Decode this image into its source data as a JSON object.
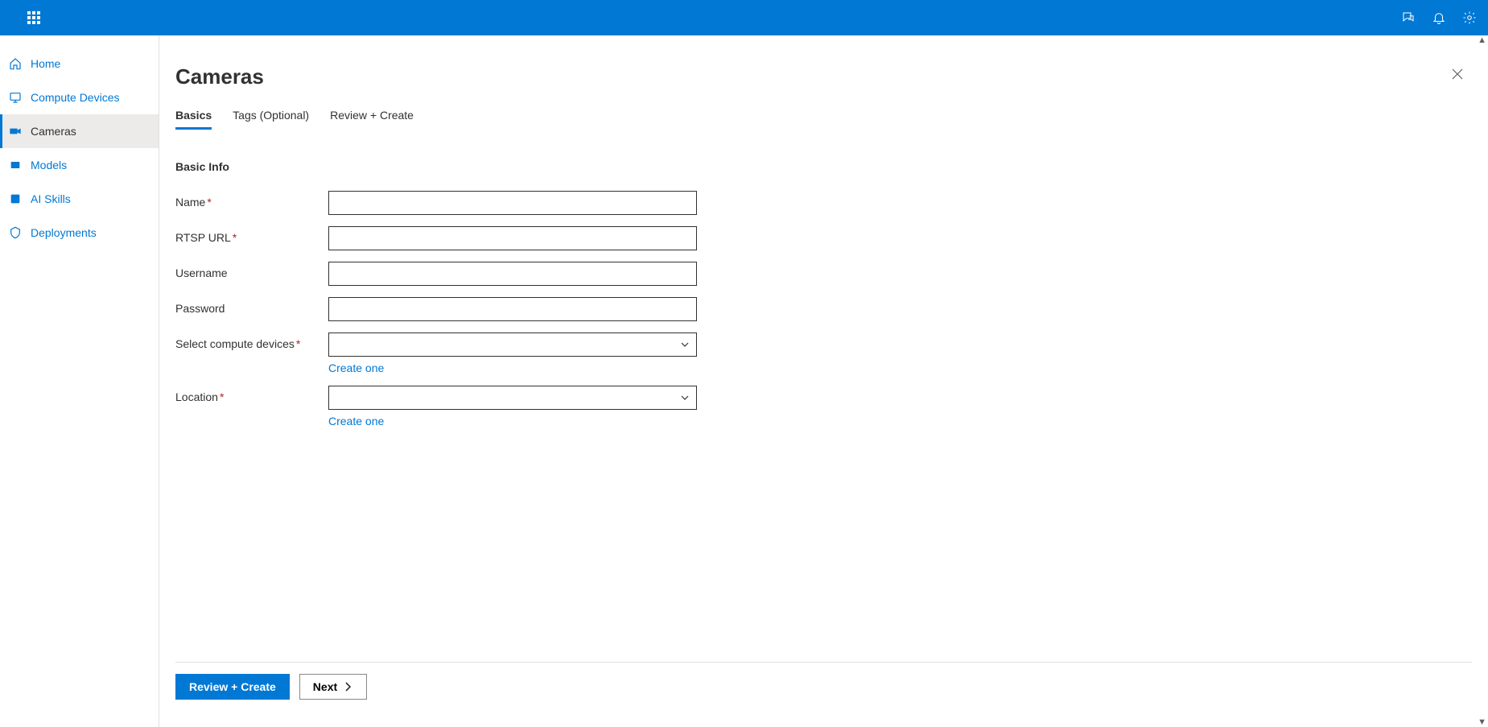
{
  "sidebar": {
    "items": [
      {
        "label": "Home",
        "icon": "home-icon",
        "active": false
      },
      {
        "label": "Compute Devices",
        "icon": "device-icon",
        "active": false
      },
      {
        "label": "Cameras",
        "icon": "camera-icon",
        "active": true
      },
      {
        "label": "Models",
        "icon": "models-icon",
        "active": false
      },
      {
        "label": "AI Skills",
        "icon": "ai-skills-icon",
        "active": false
      },
      {
        "label": "Deployments",
        "icon": "deployments-icon",
        "active": false
      }
    ]
  },
  "page": {
    "title": "Cameras"
  },
  "tabs": [
    {
      "label": "Basics",
      "active": true
    },
    {
      "label": "Tags (Optional)",
      "active": false
    },
    {
      "label": "Review + Create",
      "active": false
    }
  ],
  "form": {
    "section_heading": "Basic Info",
    "fields": {
      "name": {
        "label": "Name",
        "required": true,
        "value": "",
        "type": "text"
      },
      "rtsp": {
        "label": "RTSP URL",
        "required": true,
        "value": "",
        "type": "text"
      },
      "username": {
        "label": "Username",
        "required": false,
        "value": "",
        "type": "text"
      },
      "password": {
        "label": "Password",
        "required": false,
        "value": "",
        "type": "text"
      },
      "compute": {
        "label": "Select compute devices",
        "required": true,
        "value": "",
        "type": "select",
        "helper": "Create one"
      },
      "location": {
        "label": "Location",
        "required": true,
        "value": "",
        "type": "select",
        "helper": "Create one"
      }
    }
  },
  "footer": {
    "primary_label": "Review + Create",
    "next_label": "Next"
  }
}
